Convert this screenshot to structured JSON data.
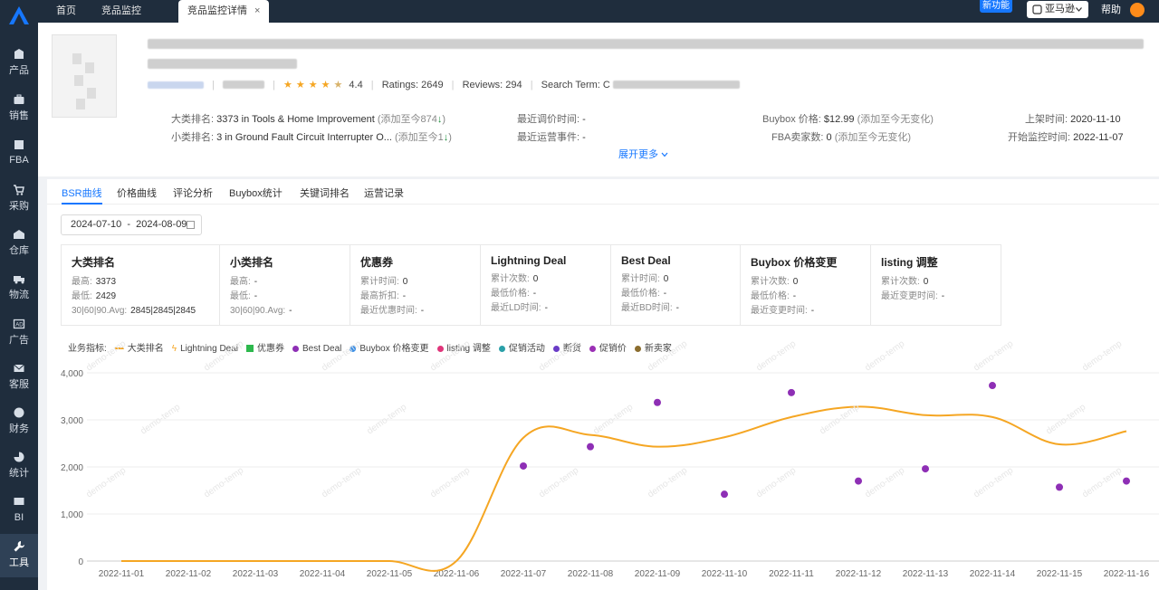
{
  "sidebar": {
    "items": [
      {
        "label": "产品",
        "icon": "box-icon"
      },
      {
        "label": "销售",
        "icon": "briefcase-icon"
      },
      {
        "label": "FBA",
        "icon": "fba-icon"
      },
      {
        "label": "采购",
        "icon": "cart-icon"
      },
      {
        "label": "仓库",
        "icon": "warehouse-icon"
      },
      {
        "label": "物流",
        "icon": "truck-icon"
      },
      {
        "label": "广告",
        "icon": "ad-icon"
      },
      {
        "label": "客服",
        "icon": "mail-icon"
      },
      {
        "label": "财务",
        "icon": "finance-icon"
      },
      {
        "label": "统计",
        "icon": "pie-chart-icon"
      },
      {
        "label": "BI",
        "icon": "bi-icon"
      },
      {
        "label": "工具",
        "icon": "tool-icon"
      }
    ],
    "active": "工具"
  },
  "topbar": {
    "tabs": [
      {
        "label": "首页"
      },
      {
        "label": "竞品监控"
      },
      {
        "label": "竞品监控详情",
        "close": "×"
      }
    ],
    "new_feature": "新功能",
    "marketplace": "亚马逊",
    "help": "帮助"
  },
  "product": {
    "rating": "4.4",
    "ratings_label": "Ratings:",
    "ratings_value": "2649",
    "reviews_label": "Reviews:",
    "reviews_value": "294",
    "search_term_label": "Search Term:",
    "search_term_value": "C",
    "rows": {
      "big_rank_label": "大类排名:",
      "big_rank_value": "3373 in Tools & Home Improvement",
      "big_rank_note": "(添加至今874",
      "big_rank_note_end": ")",
      "small_rank_label": "小类排名:",
      "small_rank_value": "3 in Ground Fault Circuit Interrupter O...",
      "small_rank_note": "(添加至今1",
      "small_rank_note_end": ")",
      "last_price_adjust_label": "最近调价时间:",
      "last_price_adjust_value": "-",
      "last_ops_label": "最近运营事件:",
      "last_ops_value": "-",
      "buybox_label": "Buybox 价格:",
      "buybox_value": "$12.99",
      "buybox_note": "(添加至今无变化)",
      "fba_sellers_label": "FBA卖家数:",
      "fba_sellers_value": "0",
      "fba_sellers_note": "(添加至今无变化)",
      "listed_label": "上架时间:",
      "listed_value": "2020-11-10",
      "monitor_start_label": "开始监控时间:",
      "monitor_start_value": "2022-11-07"
    },
    "expand_more": "展开更多"
  },
  "subtabs": [
    "BSR曲线",
    "价格曲线",
    "评论分析",
    "Buybox统计",
    "关键词排名",
    "运营记录"
  ],
  "date_range": "2024-07-10  -  2024-08-09",
  "cards": [
    {
      "title": "大类排名",
      "rows": [
        {
          "k": "最高:",
          "v": "3373"
        },
        {
          "k": "最低:",
          "v": "2429"
        },
        {
          "k": "30|60|90.Avg:",
          "v": "2845|2845|2845"
        }
      ]
    },
    {
      "title": "小类排名",
      "rows": [
        {
          "k": "最高:",
          "v": "-"
        },
        {
          "k": "最低:",
          "v": "-"
        },
        {
          "k": "30|60|90.Avg:",
          "v": "-"
        }
      ]
    },
    {
      "title": "优惠券",
      "rows": [
        {
          "k": "累计时间:",
          "v": "0"
        },
        {
          "k": "最高折扣:",
          "v": "-"
        },
        {
          "k": "最近优惠时间:",
          "v": "-"
        }
      ]
    },
    {
      "title": "Lightning Deal",
      "rows": [
        {
          "k": "累计次数:",
          "v": "0"
        },
        {
          "k": "最低价格:",
          "v": "-"
        },
        {
          "k": "最近LD时间:",
          "v": "-"
        }
      ]
    },
    {
      "title": "Best Deal",
      "rows": [
        {
          "k": "累计时间:",
          "v": "0"
        },
        {
          "k": "最低价格:",
          "v": "-"
        },
        {
          "k": "最近BD时间:",
          "v": "-"
        }
      ]
    },
    {
      "title": "Buybox 价格变更",
      "rows": [
        {
          "k": "累计次数:",
          "v": "0"
        },
        {
          "k": "最低价格:",
          "v": "-"
        },
        {
          "k": "最近变更时间:",
          "v": "-"
        }
      ]
    },
    {
      "title": "listing 调整",
      "rows": [
        {
          "k": "累计次数:",
          "v": "0"
        },
        {
          "k": "最近变更时间:",
          "v": "-"
        }
      ]
    }
  ],
  "legend": {
    "label": "业务指标:",
    "items": [
      {
        "label": "大类排名",
        "color": "#f5a623",
        "shape": "line"
      },
      {
        "label": "Lightning Deal",
        "color": "#f5a623",
        "shape": "bolt"
      },
      {
        "label": "优惠券",
        "color": "#2db84d",
        "shape": "square"
      },
      {
        "label": "Best Deal",
        "color": "#8e2fb5",
        "shape": "dot"
      },
      {
        "label": "Buybox 价格变更",
        "color": "#3a8ee6",
        "shape": "dot"
      },
      {
        "label": "listing 调整",
        "color": "#e0357a",
        "shape": "dot"
      },
      {
        "label": "促销活动",
        "color": "#2aa0a8",
        "shape": "dot"
      },
      {
        "label": "断货",
        "color": "#6a3cc7",
        "shape": "dot"
      },
      {
        "label": "促销价",
        "color": "#9b30b5",
        "shape": "dot"
      },
      {
        "label": "新卖家",
        "color": "#8b6d2e",
        "shape": "dot"
      }
    ]
  },
  "watermark": "demo-temp",
  "chart_data": {
    "type": "line",
    "x": [
      "2022-11-01",
      "2022-11-02",
      "2022-11-03",
      "2022-11-04",
      "2022-11-05",
      "2022-11-06",
      "2022-11-07",
      "2022-11-08",
      "2022-11-09",
      "2022-11-10",
      "2022-11-11",
      "2022-11-12",
      "2022-11-13",
      "2022-11-14",
      "2022-11-15",
      "2022-11-16"
    ],
    "ylim": [
      0,
      4000
    ],
    "yticks": [
      "0",
      "1,000",
      "2,000",
      "3,000",
      "4,000"
    ],
    "series": [
      {
        "name": "大类排名",
        "color": "#f5a623",
        "values": [
          0,
          0,
          0,
          0,
          0,
          0,
          2620,
          2680,
          2430,
          2630,
          3060,
          3280,
          3100,
          3060,
          2480,
          2760
        ]
      }
    ],
    "markers": {
      "color": "#8e2fb5",
      "points": [
        {
          "x": "2022-11-07",
          "y": 2020
        },
        {
          "x": "2022-11-08",
          "y": 2430
        },
        {
          "x": "2022-11-09",
          "y": 3370
        },
        {
          "x": "2022-11-10",
          "y": 1420
        },
        {
          "x": "2022-11-11",
          "y": 3580
        },
        {
          "x": "2022-11-12",
          "y": 1700
        },
        {
          "x": "2022-11-13",
          "y": 1960
        },
        {
          "x": "2022-11-14",
          "y": 3730
        },
        {
          "x": "2022-11-15",
          "y": 1570
        },
        {
          "x": "2022-11-16",
          "y": 1700
        }
      ]
    },
    "grid": true
  }
}
